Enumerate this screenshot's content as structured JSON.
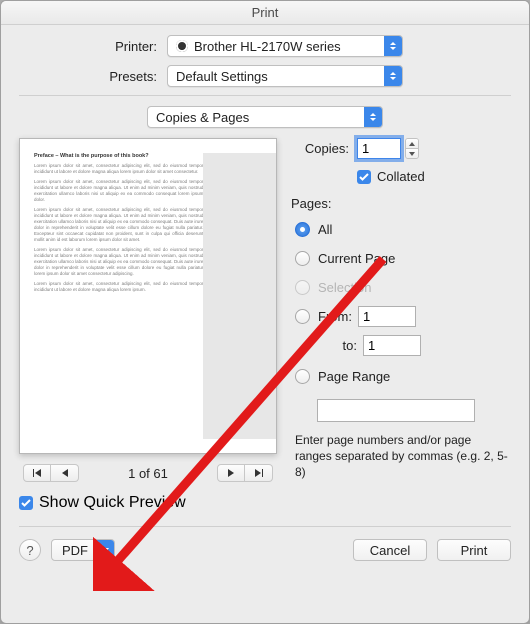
{
  "title": "Print",
  "printer": {
    "label": "Printer:",
    "value": "Brother HL-2170W series"
  },
  "presets": {
    "label": "Presets:",
    "value": "Default Settings"
  },
  "section": "Copies & Pages",
  "copies": {
    "label": "Copies:",
    "value": "1"
  },
  "collated": {
    "label": "Collated"
  },
  "pages": {
    "heading": "Pages:",
    "all": "All",
    "current": "Current Page",
    "selection": "Selection",
    "from": "From:",
    "from_value": "1",
    "to": "to:",
    "to_value": "1",
    "range": "Page Range",
    "range_value": "",
    "hint": "Enter page numbers and/or page ranges separated by commas (e.g. 2, 5-8)"
  },
  "pager": {
    "current": "1",
    "of_sep": " of ",
    "total": "61"
  },
  "show_quick_preview": "Show Quick Preview",
  "footer": {
    "help": "?",
    "pdf": "PDF",
    "cancel": "Cancel",
    "print": "Print"
  },
  "preview": {
    "title": "Preface – What is the purpose of this book?",
    "p1": "Lorem ipsum dolor sit amet, consectetur adipiscing elit, sed do eiusmod tempor incididunt ut labore et dolore magna aliqua lorem ipsum dolor sit amet consectetur.",
    "p2": "Lorem ipsum dolor sit amet, consectetur adipiscing elit, sed do eiusmod tempor incididunt ut labore et dolore magna aliqua. Ut enim ad minim veniam, quis nostrud exercitation ullamco laboris nisi ut aliquip ex ea commodo consequat lorem ipsum dolor.",
    "p3": "Lorem ipsum dolor sit amet, consectetur adipiscing elit, sed do eiusmod tempor incididunt ut labore et dolore magna aliqua. Ut enim ad minim veniam, quis nostrud exercitation ullamco laboris nisi ut aliquip ex ea commodo consequat. Duis aute irure dolor in reprehenderit in voluptate velit esse cillum dolore eu fugiat nulla pariatur. Excepteur sint occaecat cupidatat non proident, sunt in culpa qui officia deserunt mollit anim id est laborum lorem ipsum dolor sit amet.",
    "p4": "Lorem ipsum dolor sit amet, consectetur adipiscing elit, sed do eiusmod tempor incididunt ut labore et dolore magna aliqua. Ut enim ad minim veniam, quis nostrud exercitation ullamco laboris nisi ut aliquip ex ea commodo consequat. Duis aute irure dolor in reprehenderit in voluptate velit esse cillum dolore eu fugiat nulla pariatur lorem ipsum dolor sit amet consectetur adipiscing.",
    "p5": "Lorem ipsum dolor sit amet, consectetur adipiscing elit, sed do eiusmod tempor incididunt ut labore et dolore magna aliqua lorem ipsum."
  }
}
